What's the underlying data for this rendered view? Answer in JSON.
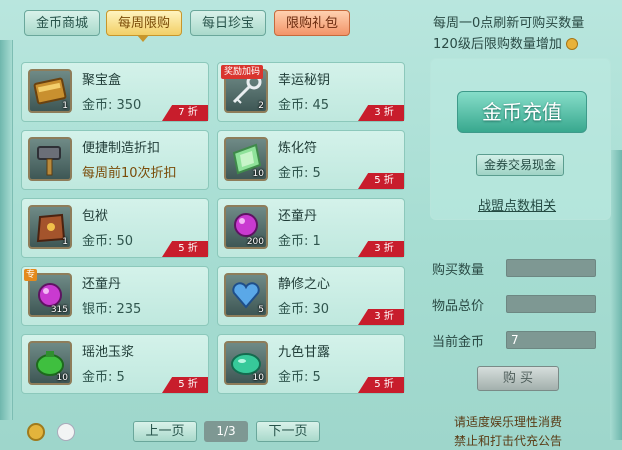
{
  "tabs": [
    {
      "label": "金币商城"
    },
    {
      "label": "每周限购"
    },
    {
      "label": "每日珍宝"
    },
    {
      "label": "限购礼包"
    }
  ],
  "items": [
    {
      "name": "聚宝盒",
      "price": "金币: 350",
      "qty": "1",
      "discount": "7 折",
      "icon": "treasure-box-icon"
    },
    {
      "name": "幸运秘钥",
      "price": "金币: 45",
      "qty": "2",
      "discount": "3 折",
      "ribbon": "奖励加码",
      "icon": "key-icon"
    },
    {
      "name": "便捷制造折扣",
      "price": "每周前10次折扣",
      "qty": "",
      "discount": "",
      "icon": "hammer-icon"
    },
    {
      "name": "炼化符",
      "price": "金币: 5",
      "qty": "10",
      "discount": "5 折",
      "icon": "talisman-icon"
    },
    {
      "name": "包袱",
      "price": "金币: 50",
      "qty": "1",
      "discount": "5 折",
      "icon": "bag-icon"
    },
    {
      "name": "还童丹",
      "price": "金币: 1",
      "qty": "200",
      "discount": "3 折",
      "icon": "pill-icon"
    },
    {
      "name": "还童丹",
      "price": "银币: 235",
      "qty": "315",
      "discount": "",
      "tag": "专",
      "icon": "pill-icon"
    },
    {
      "name": "静修之心",
      "price": "金币: 30",
      "qty": "5",
      "discount": "3 折",
      "icon": "heart-gem-icon"
    },
    {
      "name": "瑶池玉浆",
      "price": "金币: 5",
      "qty": "10",
      "discount": "5 折",
      "icon": "jade-potion-icon"
    },
    {
      "name": "九色甘露",
      "price": "金币: 5",
      "qty": "10",
      "discount": "5 折",
      "icon": "dew-gem-icon"
    }
  ],
  "info": {
    "line1": "每周一0点刷新可购买数量",
    "line2": "120级后限购数量增加"
  },
  "recharge": {
    "main_label": "金币充值",
    "exchange_label": "金券交易现金",
    "link_label": "战盟点数相关"
  },
  "form": {
    "qty_label": "购买数量",
    "qty_value": "",
    "total_label": "物品总价",
    "total_value": "",
    "coins_label": "当前金币",
    "coins_value": "7",
    "buy_label": "购 买"
  },
  "pager": {
    "prev_label": "上一页",
    "page": "1/3",
    "next_label": "下一页"
  },
  "notice": {
    "line1": "请适度娱乐理性消费",
    "line2": "禁止和打击代充公告"
  },
  "colors": {
    "discount": "#c81d2c",
    "accent_teal": "#38a88e",
    "active_tab": "#f2cf66"
  }
}
